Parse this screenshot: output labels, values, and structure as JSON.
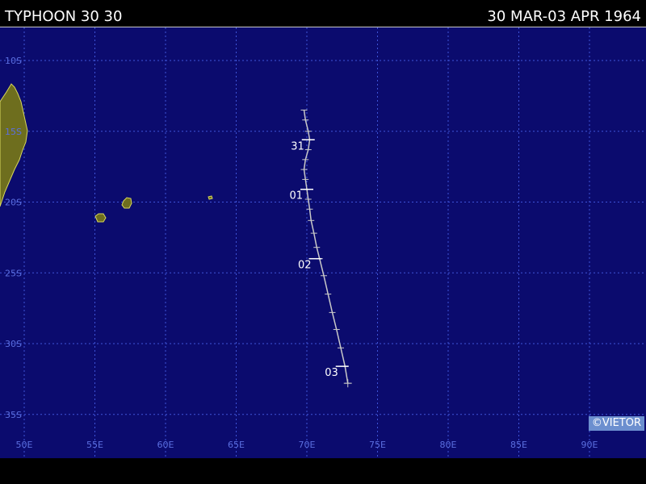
{
  "header": {
    "storm_title": "TYPHOON 30 30",
    "date_range": "30 MAR-03 APR 1964"
  },
  "credit": "©VIETOR",
  "map": {
    "lat_labels": [
      "10S",
      "15S",
      "20S",
      "25S",
      "30S",
      "35S"
    ],
    "lon_labels": [
      "50E",
      "55E",
      "60E",
      "65E",
      "70E",
      "75E",
      "80E",
      "85E",
      "90E"
    ],
    "lat_values": [
      -10,
      -15,
      -20,
      -25,
      -30,
      -35
    ],
    "lon_values": [
      50,
      55,
      60,
      65,
      70,
      75,
      80,
      85,
      90
    ],
    "track": [
      [
        69.8,
        -13.5
      ],
      [
        69.9,
        -14.2
      ],
      [
        70.1,
        -15.0
      ],
      [
        70.2,
        -15.6
      ],
      [
        70.1,
        -16.3
      ],
      [
        69.9,
        -17.0
      ],
      [
        69.8,
        -17.7
      ],
      [
        69.9,
        -18.4
      ],
      [
        70.0,
        -19.1
      ],
      [
        70.1,
        -19.8
      ],
      [
        70.2,
        -20.5
      ],
      [
        70.3,
        -21.3
      ],
      [
        70.5,
        -22.2
      ],
      [
        70.7,
        -23.2
      ],
      [
        70.9,
        -24.0
      ],
      [
        71.2,
        -25.2
      ],
      [
        71.5,
        -26.5
      ],
      [
        71.8,
        -27.8
      ],
      [
        72.1,
        -29.0
      ],
      [
        72.4,
        -30.3
      ],
      [
        72.7,
        -31.6
      ],
      [
        72.9,
        -32.8
      ]
    ],
    "day_markers": [
      {
        "label": "31",
        "lon": 70.1,
        "lat": -15.6
      },
      {
        "label": "01",
        "lon": 70.0,
        "lat": -19.1
      },
      {
        "label": "02",
        "lon": 70.6,
        "lat": -24.0
      },
      {
        "label": "03",
        "lon": 72.5,
        "lat": -31.6
      }
    ],
    "colors": {
      "ocean": "#0b0b6e",
      "grid": "#3f54d8",
      "land": "#6e6e1e",
      "coast": "#d8d85a",
      "track": "#c8c8c8",
      "label": "#ffffff",
      "axis_label": "#5b6fe0"
    }
  }
}
